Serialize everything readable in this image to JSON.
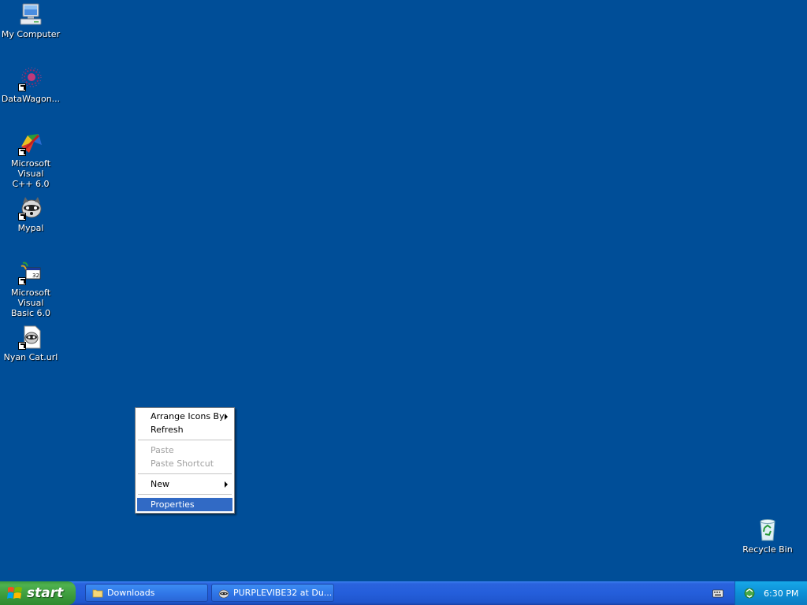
{
  "desktop": {
    "icons": [
      {
        "label": "My Computer",
        "icon": "my-computer-icon"
      },
      {
        "label": "DataWagon...",
        "icon": "datawagon-icon"
      },
      {
        "label": "Microsoft Visual\nC++ 6.0",
        "icon": "visual-cpp-icon"
      },
      {
        "label": "Mypal",
        "icon": "mypal-icon"
      },
      {
        "label": "Microsoft Visual\nBasic 6.0",
        "icon": "visual-basic-icon"
      },
      {
        "label": "Nyan Cat.url",
        "icon": "nyan-cat-url-icon"
      },
      {
        "label": "Recycle Bin",
        "icon": "recycle-bin-icon"
      }
    ]
  },
  "context_menu": {
    "arrange_icons_by": "Arrange Icons By",
    "refresh": "Refresh",
    "paste": "Paste",
    "paste_shortcut": "Paste Shortcut",
    "new": "New",
    "properties": "Properties"
  },
  "taskbar": {
    "start_label": "start",
    "tasks": [
      {
        "label": "Downloads",
        "icon": "folder-icon"
      },
      {
        "label": "PURPLEVIBE32 at Du...",
        "icon": "raccoon-icon"
      }
    ],
    "clock": "6:30 PM"
  },
  "colors": {
    "desktop_bg": "#004e98",
    "menu_highlight": "#316ac5",
    "taskbar_blue": "#245edb",
    "start_green": "#3c9b3c",
    "tray_blue": "#0d8fd6"
  }
}
